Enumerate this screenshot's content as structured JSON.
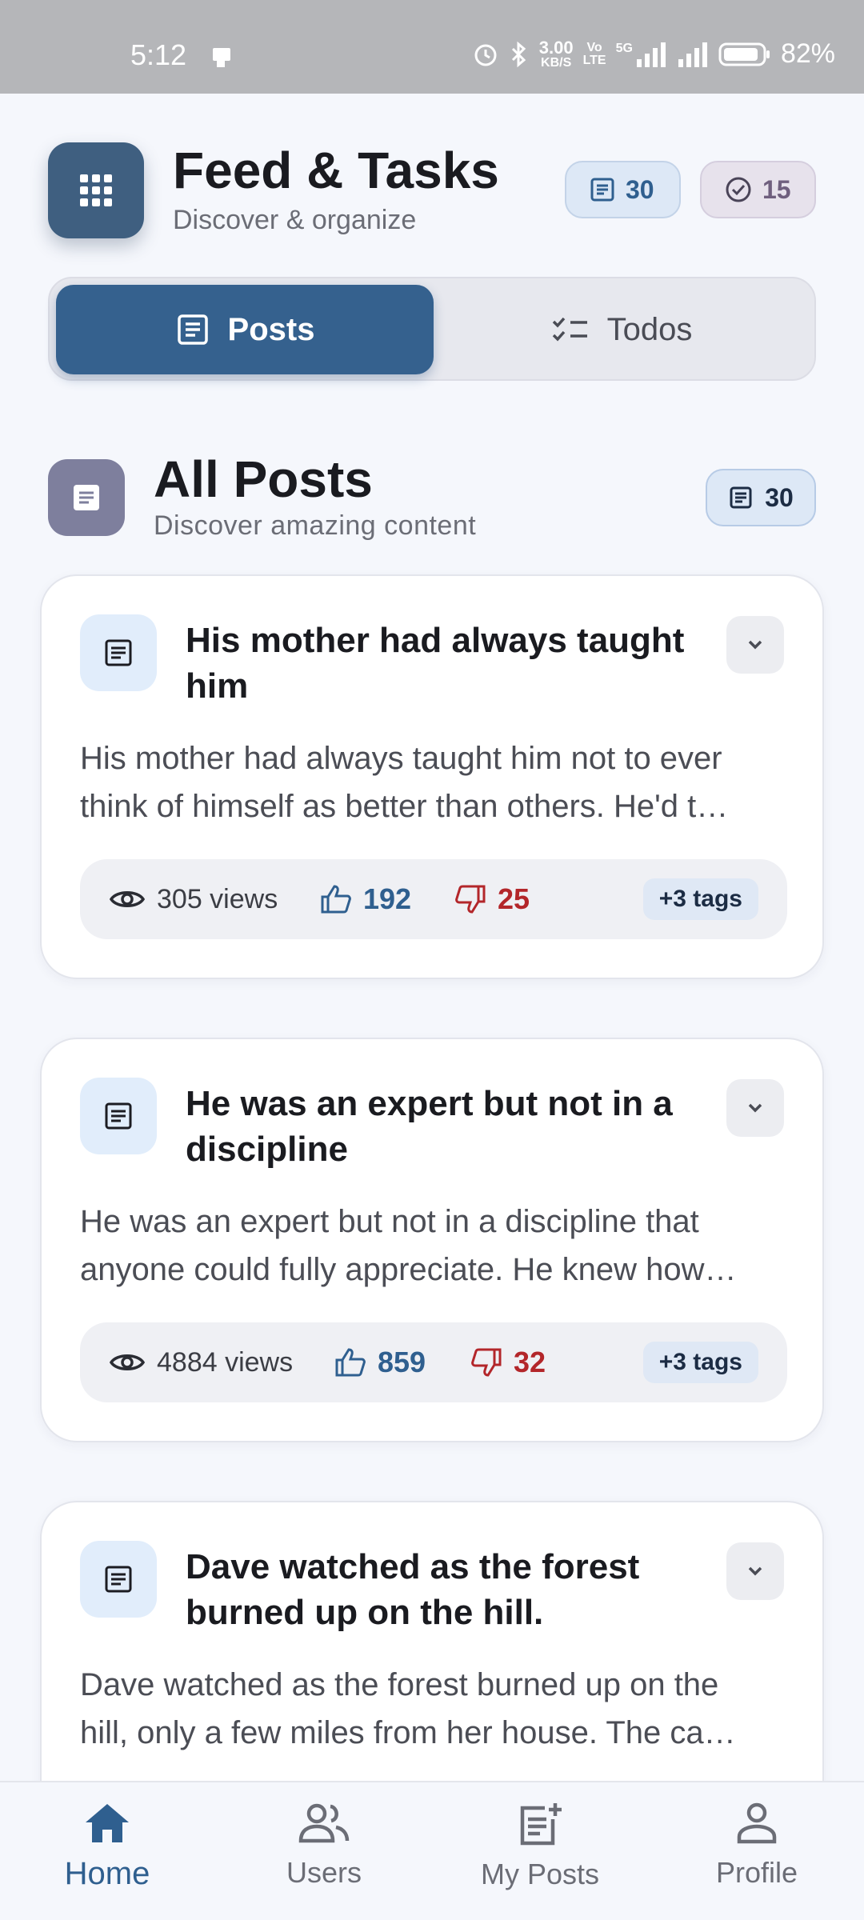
{
  "status_bar": {
    "time": "5:12",
    "net_speed": "3.00",
    "net_unit": "KB/S",
    "volte_top": "Vo",
    "volte_bottom": "LTE",
    "net_type": "5G",
    "battery": "82%"
  },
  "header": {
    "title": "Feed & Tasks",
    "subtitle": "Discover & organize",
    "posts_count": "30",
    "todos_count": "15"
  },
  "tabs": [
    {
      "label": "Posts",
      "active": true
    },
    {
      "label": "Todos",
      "active": false
    }
  ],
  "section": {
    "title": "All Posts",
    "subtitle": "Discover amazing content",
    "count": "30"
  },
  "posts": [
    {
      "title": "His mother had always taught him",
      "body_line1": "His mother had always taught him not to ever",
      "body_line2": "think of himself as better than others. He'd t…",
      "views": "305 views",
      "likes": "192",
      "dislikes": "25",
      "tags": "+3 tags"
    },
    {
      "title": "He was an expert but not in a discipline",
      "body_line1": "He was an expert but not in a discipline that",
      "body_line2": "anyone could fully appreciate. He knew how…",
      "views": "4884 views",
      "likes": "859",
      "dislikes": "32",
      "tags": "+3 tags"
    },
    {
      "title": "Dave watched as the forest burned up on the hill.",
      "body_line1": "Dave watched as the forest burned up on the",
      "body_line2": "hill, only a few miles from her house. The ca…"
    }
  ],
  "bottom_nav": [
    {
      "label": "Home",
      "icon": "home-icon",
      "active": true
    },
    {
      "label": "Users",
      "icon": "users-icon",
      "active": false
    },
    {
      "label": "My Posts",
      "icon": "post-add-icon",
      "active": false
    },
    {
      "label": "Profile",
      "icon": "person-icon",
      "active": false
    }
  ],
  "colors": {
    "accent": "#35618e",
    "like": "#2f5f8f",
    "dislike": "#b3262a",
    "status_bar": "#b5b6b9"
  }
}
